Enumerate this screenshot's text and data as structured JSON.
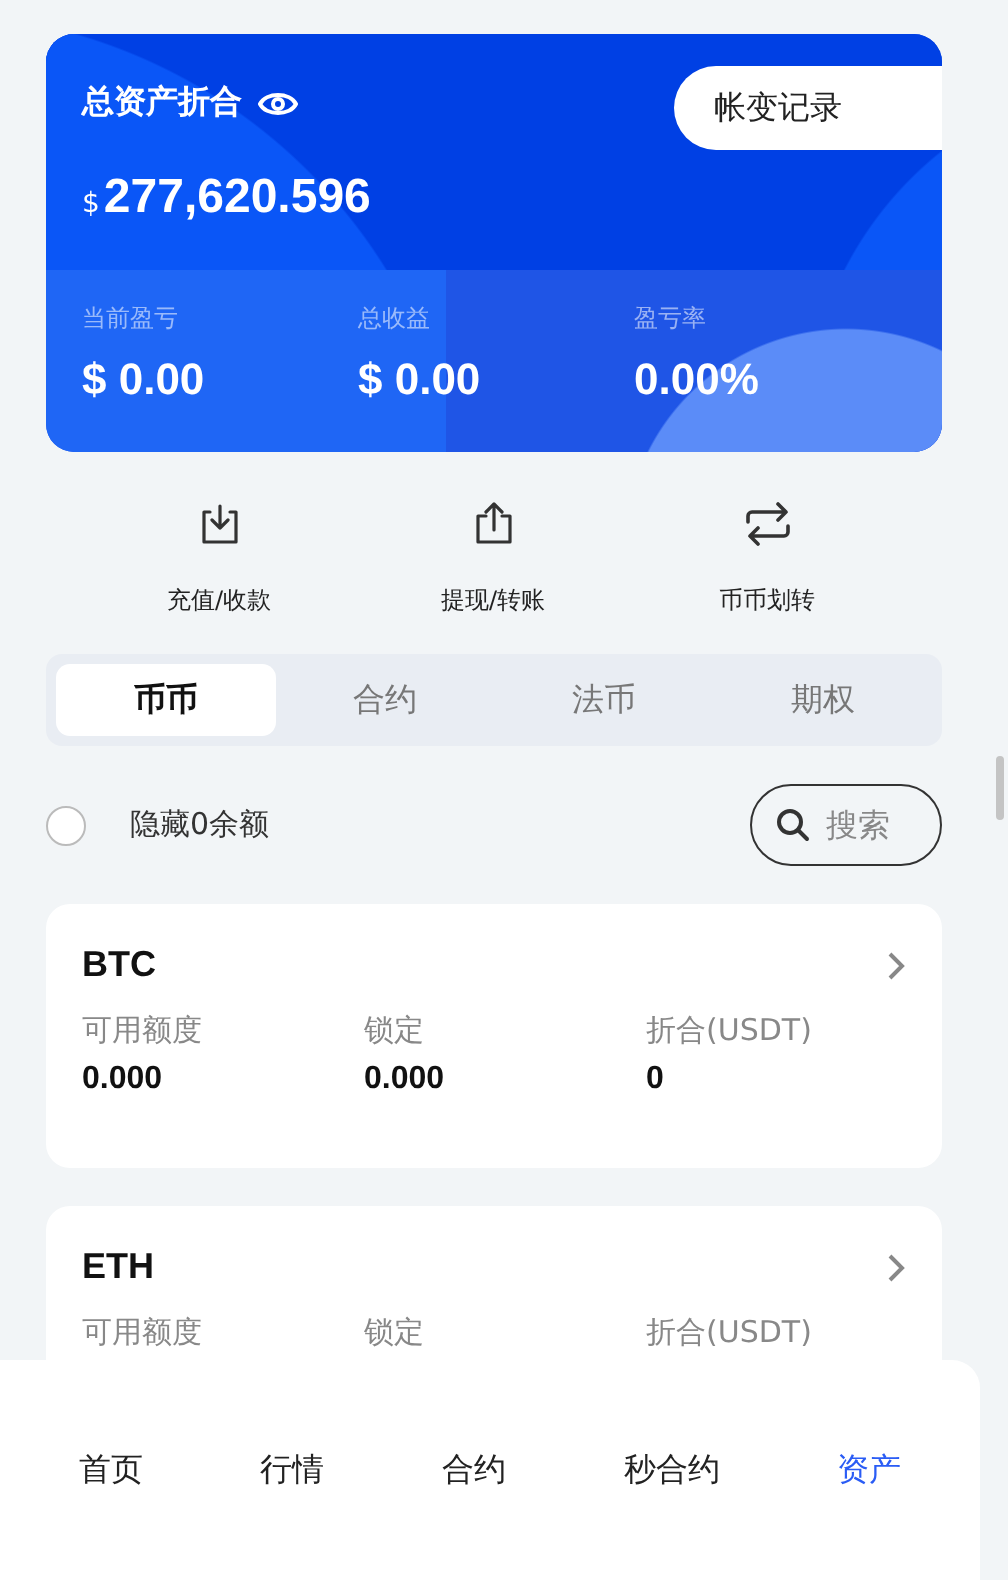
{
  "asset_card": {
    "title": "总资产折合",
    "currency": "$",
    "total": "277,620.596",
    "history_button": "帐变记录",
    "stats": [
      {
        "label": "当前盈亏",
        "value": "$ 0.00"
      },
      {
        "label": "总收益",
        "value": "$ 0.00"
      },
      {
        "label": "盈亏率",
        "value": "0.00%"
      }
    ]
  },
  "actions": [
    {
      "label": "充值/收款",
      "kind": "deposit"
    },
    {
      "label": "提现/转账",
      "kind": "withdraw"
    },
    {
      "label": "币币划转",
      "kind": "transfer"
    }
  ],
  "tabs": [
    {
      "label": "币币",
      "selected": true
    },
    {
      "label": "合约",
      "selected": false
    },
    {
      "label": "法币",
      "selected": false
    },
    {
      "label": "期权",
      "selected": false
    }
  ],
  "filter": {
    "hide_zero": {
      "label": "隐藏0余额",
      "checked": false
    },
    "search": {
      "placeholder": "搜索"
    }
  },
  "assets": [
    {
      "symbol": "BTC",
      "fields": [
        {
          "label": "可用额度",
          "value": "0.000"
        },
        {
          "label": "锁定",
          "value": "0.000"
        },
        {
          "label": "折合(USDT)",
          "value": "0"
        }
      ]
    },
    {
      "symbol": "ETH",
      "fields": [
        {
          "label": "可用额度"
        },
        {
          "label": "锁定"
        },
        {
          "label": "折合(USDT)"
        }
      ]
    }
  ],
  "bottom_nav": [
    {
      "label": "首页",
      "selected": false
    },
    {
      "label": "行情",
      "selected": false
    },
    {
      "label": "合约",
      "selected": false
    },
    {
      "label": "秒合约",
      "selected": false
    },
    {
      "label": "资产",
      "selected": true
    }
  ]
}
